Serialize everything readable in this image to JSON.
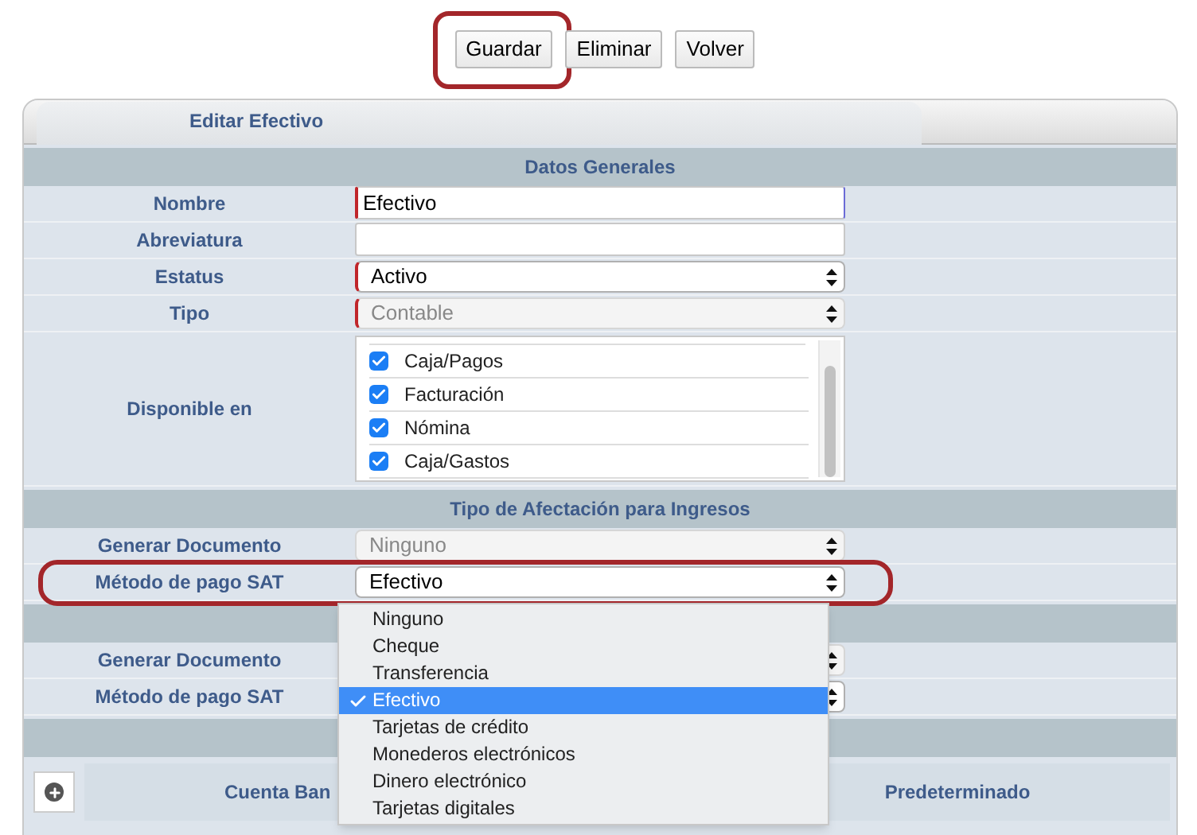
{
  "buttons": [
    {
      "label": "Guardar",
      "highlighted": true
    },
    {
      "label": "Eliminar",
      "highlighted": false
    },
    {
      "label": "Volver",
      "highlighted": false
    }
  ],
  "tab": {
    "label": "Editar Efectivo"
  },
  "sections": [
    {
      "title": "Datos Generales",
      "rows": [
        {
          "kind": "text",
          "label": "Nombre",
          "value": "Efectivo",
          "required": true,
          "focused": true
        },
        {
          "kind": "text",
          "label": "Abreviatura",
          "required": false,
          "focused": false
        },
        {
          "kind": "select",
          "label": "Estatus",
          "value": "Activo",
          "required": true,
          "disabled": false
        },
        {
          "kind": "select",
          "label": "Tipo",
          "value": "Contable",
          "required": true,
          "disabled": true
        },
        {
          "kind": "checklist",
          "label": "Disponible en",
          "items": [
            {
              "label": "Caja/Pagos",
              "checked": true
            },
            {
              "label": "Facturación",
              "checked": true
            },
            {
              "label": "Nómina",
              "checked": true
            },
            {
              "label": "Caja/Gastos",
              "checked": true
            }
          ]
        }
      ]
    },
    {
      "title": "Tipo de Afectación para Ingresos",
      "rows": [
        {
          "kind": "select",
          "label": "Generar Documento",
          "value": "Ninguno",
          "required": false,
          "disabled": true
        },
        {
          "kind": "select",
          "label": "Método de pago SAT",
          "value": "Efectivo",
          "required": false,
          "disabled": false,
          "highlighted": true,
          "open": true
        }
      ]
    },
    {
      "rows": [
        {
          "kind": "select",
          "label": "Generar Documento",
          "disabled": true
        },
        {
          "kind": "select",
          "label": "Método de pago SAT",
          "disabled": false
        }
      ]
    }
  ],
  "table": {
    "columns": [
      "Cuenta Ban",
      "Predeterminado"
    ]
  },
  "dropdown": {
    "options": [
      {
        "label": "Ninguno",
        "selected": false
      },
      {
        "label": "Cheque",
        "selected": false
      },
      {
        "label": "Transferencia",
        "selected": false
      },
      {
        "label": "Efectivo",
        "selected": true
      },
      {
        "label": "Tarjetas de crédito",
        "selected": false
      },
      {
        "label": "Monederos electrónicos",
        "selected": false
      },
      {
        "label": "Dinero electrónico",
        "selected": false
      },
      {
        "label": "Tarjetas digitales",
        "selected": false
      }
    ]
  }
}
